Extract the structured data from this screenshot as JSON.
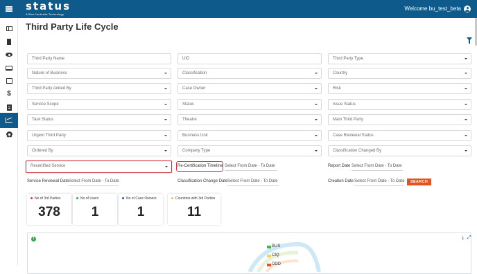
{
  "app": {
    "logo": "status",
    "logo_sub": "A Blue Umbrella Technology",
    "welcome": "Welcome bu_test_beta",
    "accent": "#0e5a8a",
    "highlight": "#d0303b",
    "button_color": "#e5541e"
  },
  "sidebar": {
    "items": [
      {
        "icon": "dashboard-icon"
      },
      {
        "icon": "building-icon"
      },
      {
        "icon": "eye-icon"
      },
      {
        "icon": "laptop-icon"
      },
      {
        "icon": "edit-icon"
      },
      {
        "icon": "dollar-icon",
        "glyph": "$"
      },
      {
        "icon": "document-icon"
      },
      {
        "icon": "chart-icon",
        "active": true
      },
      {
        "icon": "settings-icon"
      }
    ]
  },
  "page": {
    "title": "Third Party Life Cycle"
  },
  "filters": {
    "third_party_name": "Third Party Name",
    "uid": "UID",
    "third_party_type": "Third Party Type",
    "nature_of_business": "Nature of Business",
    "classification": "Classification",
    "country": "Country",
    "third_party_added_by": "Third Party Added By",
    "case_owner": "Case Owner",
    "risk": "Risk",
    "service_scope": "Service Scope",
    "status": "Status",
    "issue_status": "Issue Status",
    "task_status": "Task Status",
    "theatre": "Theatre",
    "main_third_party": "Main Third Party",
    "urgent_third_party": "Urgent Third Party",
    "business_unit": "Business Unit",
    "case_reviewal_status": "Case Reviewal Status",
    "ordered_by": "Ordered By",
    "company_type": "Company Type",
    "classification_changed_by": "Classification Changed By",
    "recertified_service": "Recertified Service"
  },
  "date_filters": {
    "recert_timeline_label": "Re-Certification Timeline",
    "report_date_label": "Report Date",
    "service_reviewal_label": "Service Reviewal Date",
    "classification_change_label": "Classification Change Date",
    "creation_date_label": "Creation Date",
    "placeholder": "Select From Date - To Date",
    "search_label": "SEARCH"
  },
  "stats": [
    {
      "label": "No of 3rd Parties",
      "value": "378",
      "dot_color": "#e0343e"
    },
    {
      "label": "No of Users",
      "value": "1",
      "dot_color": "#3aa84a"
    },
    {
      "label": "No of Case Owners",
      "value": "1",
      "dot_color": "#2b4fb3"
    },
    {
      "label": "Countries with 3rd Parties",
      "value": "11",
      "dot_color": "#f2c23a"
    }
  ],
  "chart_panel": {
    "info_glyph": "i",
    "download_glyph": "⤓",
    "expand_glyph": "⤢",
    "legend": [
      {
        "name": "BUS",
        "color": "#4caf50"
      },
      {
        "name": "CIQ",
        "color": "#f2d25a"
      },
      {
        "name": "DDD",
        "color": "#e5541e"
      }
    ]
  }
}
